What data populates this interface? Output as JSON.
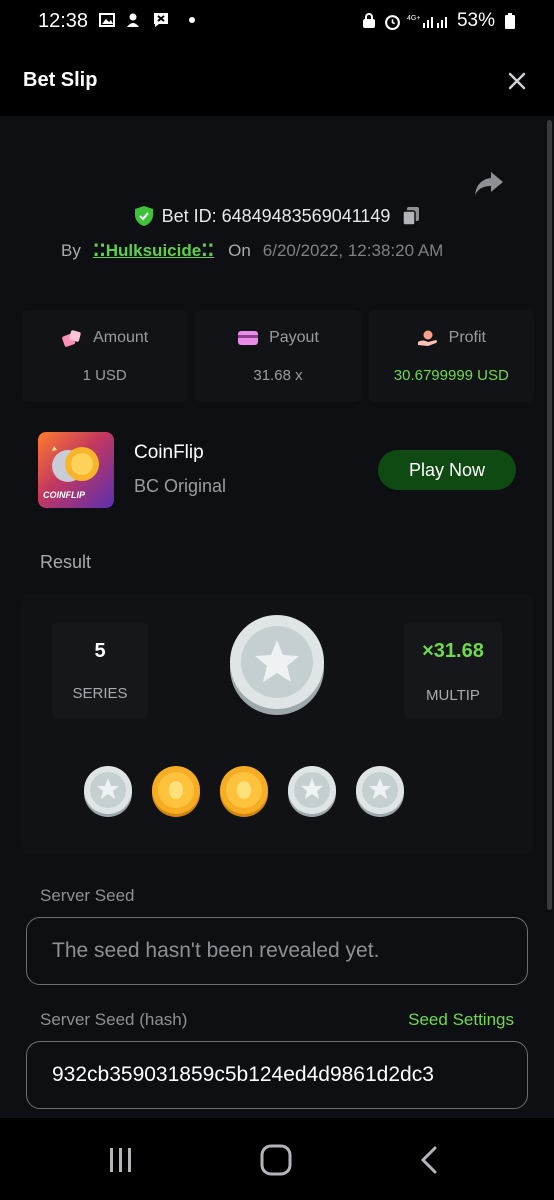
{
  "status_bar": {
    "time": "12:38",
    "battery": "53%"
  },
  "header": {
    "title": "Bet Slip"
  },
  "bet": {
    "id_text": "Bet ID: 64849483569041149",
    "by_label": "By",
    "user": "⁚⁚Hulksuicide⁚⁚",
    "on_label": "On",
    "date": "6/20/2022, 12:38:20 AM"
  },
  "stats": [
    {
      "label": "Amount",
      "value": "1 USD",
      "icon": "dice-icon",
      "color": "#9a9ca2"
    },
    {
      "label": "Payout",
      "value": "31.68 x",
      "icon": "card-icon",
      "color": "#9a9ca2"
    },
    {
      "label": "Profit",
      "value": "30.6799999 USD",
      "icon": "hand-coin-icon",
      "color": "#6fd94f"
    }
  ],
  "game": {
    "name": "CoinFlip",
    "subtitle": "BC Original",
    "thumb_label": "COINFLIP",
    "play_label": "Play Now"
  },
  "result": {
    "label": "Result",
    "series_value": "5",
    "series_label": "SERIES",
    "multiplier_value": "×31.68",
    "multiplier_label": "MULTIP",
    "main_coin": "silver",
    "coins": [
      "silver",
      "gold",
      "gold",
      "silver",
      "silver"
    ]
  },
  "server_seed": {
    "label": "Server Seed",
    "placeholder": "The seed hasn't been revealed yet."
  },
  "server_seed_hash": {
    "label": "Server Seed (hash)",
    "settings_label": "Seed Settings",
    "value": "932cb359031859c5b124ed4d9861d2dc3"
  },
  "colors": {
    "accent_green": "#6fd94f",
    "play_button": "#0f4a12",
    "background": "#0e0f12"
  }
}
